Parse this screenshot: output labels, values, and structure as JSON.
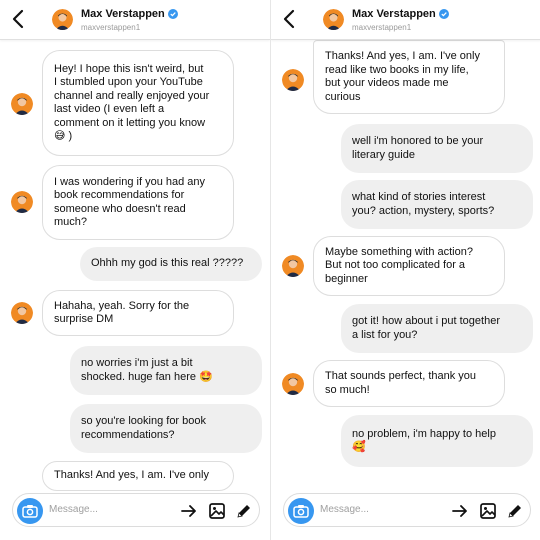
{
  "contact": {
    "name": "Max Verstappen",
    "username": "maxverstappen1"
  },
  "composer": {
    "placeholder": "Message..."
  },
  "colors": {
    "camera": "#3797f0",
    "verified": "#3797f0",
    "sent_bubble": "#efefef",
    "received_bubble_border": "#dddddd"
  },
  "icons": [
    "back-arrow-icon",
    "verified-badge-icon",
    "camera-icon",
    "send-arrow-icon",
    "gallery-icon",
    "pencil-icon"
  ],
  "screens": [
    {
      "messages": [
        {
          "from": "them",
          "text": "Hey! I hope this isn't weird, but\nI stumbled upon your YouTube\nchannel and really enjoyed your\nlast video (I even left a\ncomment on it letting you know\n😅 )"
        },
        {
          "from": "them",
          "text": "I was wondering if you had any\nbook recommendations for\nsomeone who doesn't read\nmuch?"
        },
        {
          "from": "me",
          "text": "Ohhh my god is this real ?????"
        },
        {
          "from": "them",
          "text": "Hahaha, yeah. Sorry for the\nsurprise DM"
        },
        {
          "from": "me",
          "text": "no worries i'm just a bit\nshocked. huge fan here 🤩"
        },
        {
          "from": "me",
          "text": "so you're looking for book\nrecommendations?"
        },
        {
          "from": "them",
          "text": "Thanks! And yes, I am. I've only"
        }
      ]
    },
    {
      "messages": [
        {
          "from": "them",
          "text": "Thanks! And yes, I am. I've only\nread like two books in my life,\nbut your videos made me\ncurious"
        },
        {
          "from": "me",
          "text": "well i'm honored to be your\nliterary guide"
        },
        {
          "from": "me",
          "text": "what kind of stories interest\nyou? action, mystery, sports?"
        },
        {
          "from": "them",
          "text": "Maybe something with action?\nBut not too complicated for a\nbeginner"
        },
        {
          "from": "me",
          "text": "got it! how about i put together\na list for you?"
        },
        {
          "from": "them",
          "text": "That sounds perfect, thank you\nso much!"
        },
        {
          "from": "me",
          "text": "no problem, i'm happy to help\n🥰"
        }
      ]
    }
  ]
}
